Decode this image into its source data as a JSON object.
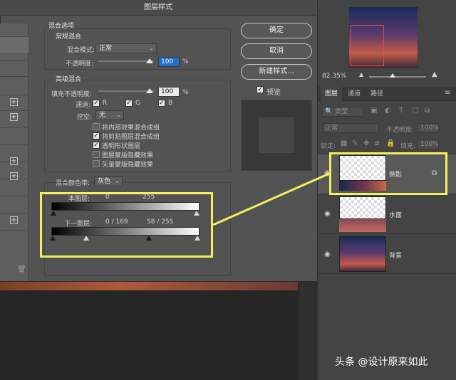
{
  "dialog": {
    "title": "图层样式",
    "blend_options_title": "混合选项",
    "general_blending": {
      "title": "常规混合",
      "blend_mode_label": "混合模式:",
      "blend_mode_value": "正常",
      "opacity_label": "不透明度:",
      "opacity_value": "100",
      "percent": "%"
    },
    "advanced_blending": {
      "title": "高级混合",
      "fill_opacity_label": "填充不透明度:",
      "fill_opacity_value": "100",
      "percent": "%",
      "channels_label": "通道:",
      "channel_r": "R",
      "channel_g": "G",
      "channel_b": "B",
      "knockout_label": "挖空:",
      "knockout_value": "无",
      "options": [
        {
          "label": "将内部效果混合成组",
          "checked": false
        },
        {
          "label": "将剪贴图层混合成组",
          "checked": true
        },
        {
          "label": "透明形状图层",
          "checked": true
        },
        {
          "label": "图层蒙版隐藏效果",
          "checked": false
        },
        {
          "label": "矢量蒙版隐藏效果",
          "checked": false
        }
      ]
    },
    "blend_if": {
      "label": "混合颜色带:",
      "value": "灰色",
      "this_layer_label": "本图层:",
      "this_layer_low": "0",
      "this_layer_high": "255",
      "underlying_label": "下一图层:",
      "underlying_values": "0 / 169",
      "underlying_values_2": "58 / 255"
    },
    "buttons": {
      "ok": "确定",
      "cancel": "取消",
      "new_style": "新建样式..."
    },
    "preview_label": "预览",
    "preview_checked": true
  },
  "layers_panel": {
    "zoom": "82.35%",
    "tabs": [
      "图层",
      "通道",
      "路径"
    ],
    "filter_label": "类型",
    "blend_mode": "正常",
    "opacity_label": "不透明度:",
    "opacity_value": "100%",
    "lock_label": "锁定:",
    "fill_label": "填充:",
    "fill_value": "100%",
    "layers": [
      {
        "name": "倒影",
        "selected": true
      },
      {
        "name": "水面",
        "selected": false
      },
      {
        "name": "背景",
        "selected": false
      }
    ]
  },
  "watermark": "头条 @设计原来如此",
  "colors": {
    "highlight": "#f4f05a",
    "selected_field": "#1e6fd0"
  }
}
